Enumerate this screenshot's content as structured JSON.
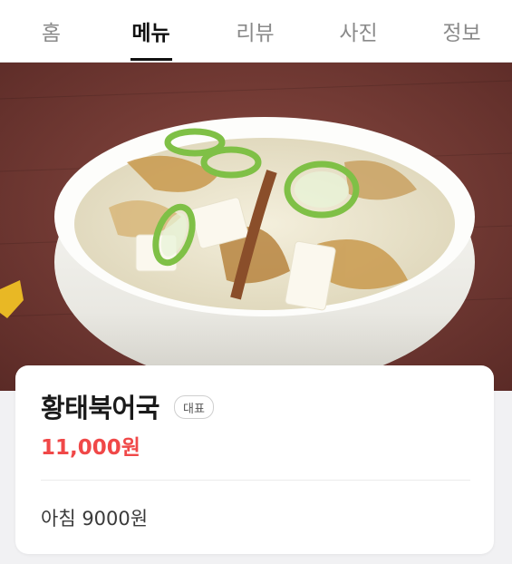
{
  "tabs": [
    {
      "label": "홈"
    },
    {
      "label": "메뉴"
    },
    {
      "label": "리뷰"
    },
    {
      "label": "사진"
    },
    {
      "label": "정보"
    }
  ],
  "active_tab": "메뉴",
  "menu_item": {
    "name": "황태북어국",
    "badge": "대표",
    "price": "11,000원",
    "description": "아침 9000원"
  },
  "colors": {
    "price": "#f04848",
    "active_tab": "#111111",
    "inactive_tab": "#8a8a8a"
  }
}
